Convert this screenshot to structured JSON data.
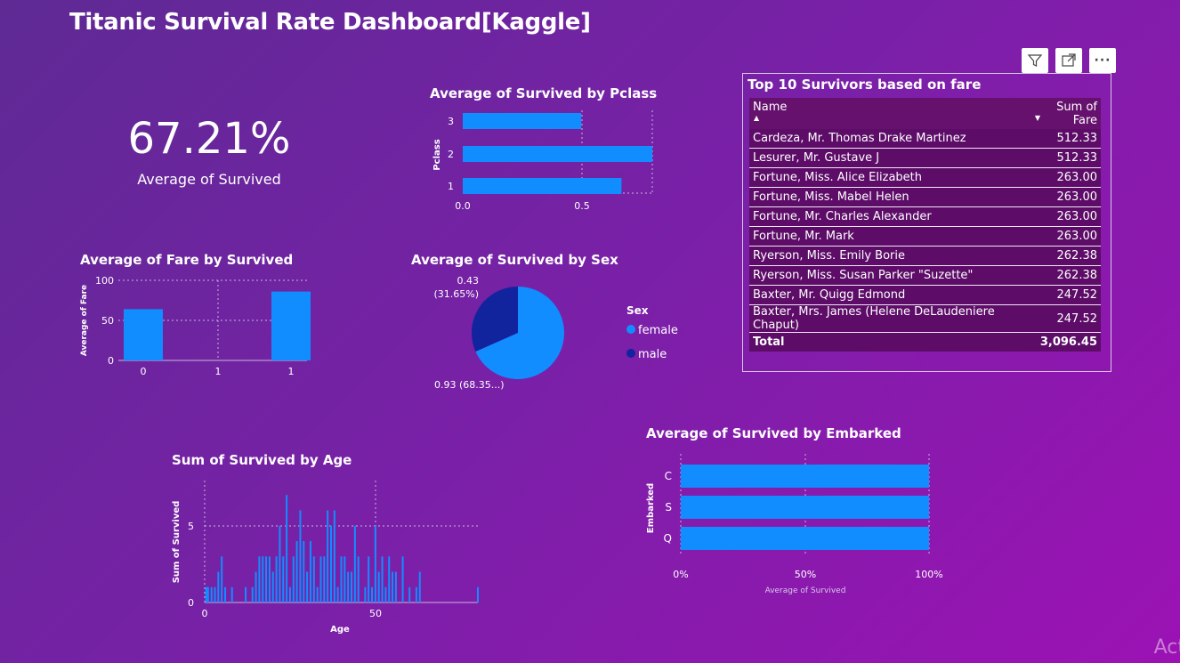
{
  "dashboard_title": "Titanic Survival Rate Dashboard[Kaggle]",
  "kpi": {
    "value": "67.21%",
    "label": "Average of Survived"
  },
  "toolbar": {
    "filter_icon": "filter-icon",
    "focus_icon": "focus-mode-icon",
    "more_icon": "more-options-icon",
    "more_label": "···"
  },
  "pclass": {
    "title": "Average of Survived by Pclass",
    "ylabel": "Pclass",
    "xticks": [
      "0.0",
      "0.5"
    ]
  },
  "fare": {
    "title": "Average of Fare by Survived",
    "ylabel": "Average of Fare",
    "yticks": [
      "100",
      "50",
      "0"
    ],
    "xticks": [
      "0",
      "1",
      "1"
    ]
  },
  "sex": {
    "title": "Average of Survived by Sex",
    "label_male": "0.43",
    "label_male_pct": "(31.65%)",
    "label_female": "0.93 (68.35...)",
    "legend_title": "Sex",
    "legend": [
      "female",
      "male"
    ]
  },
  "age": {
    "title": "Sum of Survived by Age",
    "ylabel": "Sum of Survived",
    "xlabel": "Age",
    "yticks": [
      "5",
      "0"
    ],
    "xticks": [
      "0",
      "50"
    ]
  },
  "embarked": {
    "title": "Average of Survived by Embarked",
    "ylabel": "Embarked",
    "xlabel": "Average of Survived",
    "xticks": [
      "0%",
      "50%",
      "100%"
    ]
  },
  "table": {
    "title": "Top 10 Survivors based on fare",
    "col_name": "Name",
    "col_fare": "Sum of Fare",
    "rows": [
      {
        "name": "Cardeza, Mr. Thomas Drake Martinez",
        "fare": "512.33"
      },
      {
        "name": "Lesurer, Mr. Gustave J",
        "fare": "512.33"
      },
      {
        "name": "Fortune, Miss. Alice Elizabeth",
        "fare": "263.00"
      },
      {
        "name": "Fortune, Miss. Mabel Helen",
        "fare": "263.00"
      },
      {
        "name": "Fortune, Mr. Charles Alexander",
        "fare": "263.00"
      },
      {
        "name": "Fortune, Mr. Mark",
        "fare": "263.00"
      },
      {
        "name": "Ryerson, Miss. Emily Borie",
        "fare": "262.38"
      },
      {
        "name": "Ryerson, Miss. Susan Parker \"Suzette\"",
        "fare": "262.38"
      },
      {
        "name": "Baxter, Mr. Quigg Edmond",
        "fare": "247.52"
      },
      {
        "name": "Baxter, Mrs. James (Helene DeLaudeniere Chaput)",
        "fare": "247.52"
      }
    ],
    "total_label": "Total",
    "total_value": "3,096.45"
  },
  "watermark": "Act",
  "colors": {
    "bar": "#118dff",
    "dark": "#12239e",
    "bg_start": "#5e2a94",
    "bg_end": "#9c12b4"
  },
  "chart_data": [
    {
      "type": "bar",
      "orientation": "horizontal",
      "title": "Average of Survived by Pclass",
      "ylabel": "Pclass",
      "categories": [
        "3",
        "2",
        "1"
      ],
      "values": [
        0.5,
        0.8,
        0.67
      ],
      "xlim": [
        0,
        0.8
      ]
    },
    {
      "type": "bar",
      "title": "Average of Fare by Survived",
      "ylabel": "Average of Fare",
      "categories": [
        "0",
        "1",
        "1"
      ],
      "values": [
        64,
        0,
        86
      ],
      "ylim": [
        0,
        100
      ]
    },
    {
      "type": "pie",
      "title": "Average of Survived by Sex",
      "categories": [
        "female",
        "male"
      ],
      "values": [
        0.93,
        0.43
      ]
    },
    {
      "type": "bar",
      "title": "Sum of Survived by Age",
      "xlabel": "Age",
      "ylabel": "Sum of Survived",
      "x": [
        0.42,
        0.67,
        0.83,
        0.92,
        1,
        2,
        3,
        4,
        5,
        6,
        8,
        12,
        14,
        15,
        16,
        17,
        18,
        19,
        20,
        21,
        22,
        23,
        24,
        25,
        26,
        27,
        28,
        29,
        30,
        31,
        32,
        33,
        34,
        35,
        36,
        37,
        38,
        39,
        40,
        41,
        42,
        43,
        44,
        45,
        47,
        48,
        49,
        50,
        51,
        52,
        53,
        54,
        55,
        56,
        58,
        60,
        62,
        63,
        80
      ],
      "values": [
        1,
        1,
        1,
        1,
        1,
        1,
        1,
        2,
        3,
        1,
        1,
        1,
        1,
        2,
        3,
        3,
        3,
        3,
        2,
        3,
        5,
        3,
        7,
        1,
        3,
        4,
        6,
        4,
        2,
        4,
        3,
        1,
        3,
        3,
        6,
        5,
        6,
        1,
        3,
        3,
        2,
        2,
        5,
        3,
        1,
        3,
        1,
        5,
        2,
        3,
        1,
        3,
        2,
        2,
        3,
        1,
        1,
        2,
        1
      ],
      "ylim": [
        0,
        8
      ],
      "xlim": [
        0,
        80
      ]
    },
    {
      "type": "bar",
      "orientation": "horizontal",
      "title": "Average of Survived by Embarked",
      "ylabel": "Embarked",
      "xlabel": "Average of Survived",
      "categories": [
        "C",
        "S",
        "Q"
      ],
      "values": [
        100,
        100,
        100
      ],
      "xlim": [
        0,
        100
      ]
    }
  ]
}
